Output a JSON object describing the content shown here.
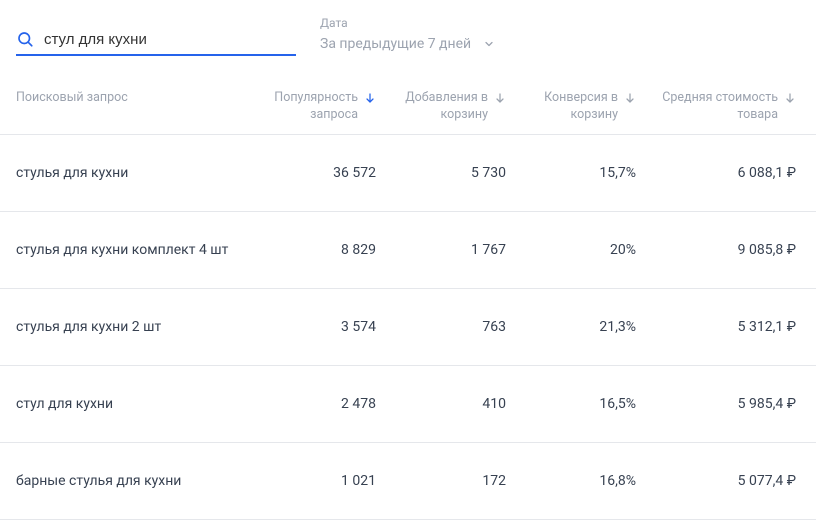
{
  "search": {
    "value": "стул для кухни",
    "placeholder": ""
  },
  "dateFilter": {
    "label": "Дата",
    "selected": "За предыдущие 7 дней"
  },
  "columns": {
    "query": "Поисковый запрос",
    "popularity": "Популярность запроса",
    "cartAdds": "Добавления в корзину",
    "conversion": "Конверсия в корзину",
    "avgPrice": "Средняя стоимость товара"
  },
  "rows": [
    {
      "query": "стулья для кухни",
      "popularity": "36 572",
      "cartAdds": "5 730",
      "conversion": "15,7%",
      "avgPrice": "6 088,1 ₽"
    },
    {
      "query": "стулья для кухни комплект 4 шт",
      "popularity": "8 829",
      "cartAdds": "1 767",
      "conversion": "20%",
      "avgPrice": "9 085,8 ₽"
    },
    {
      "query": "стулья для кухни 2 шт",
      "popularity": "3 574",
      "cartAdds": "763",
      "conversion": "21,3%",
      "avgPrice": "5 312,1 ₽"
    },
    {
      "query": "стул для кухни",
      "popularity": "2 478",
      "cartAdds": "410",
      "conversion": "16,5%",
      "avgPrice": "5 985,4 ₽"
    },
    {
      "query": "барные стулья для кухни",
      "popularity": "1 021",
      "cartAdds": "172",
      "conversion": "16,8%",
      "avgPrice": "5 077,4 ₽"
    }
  ]
}
